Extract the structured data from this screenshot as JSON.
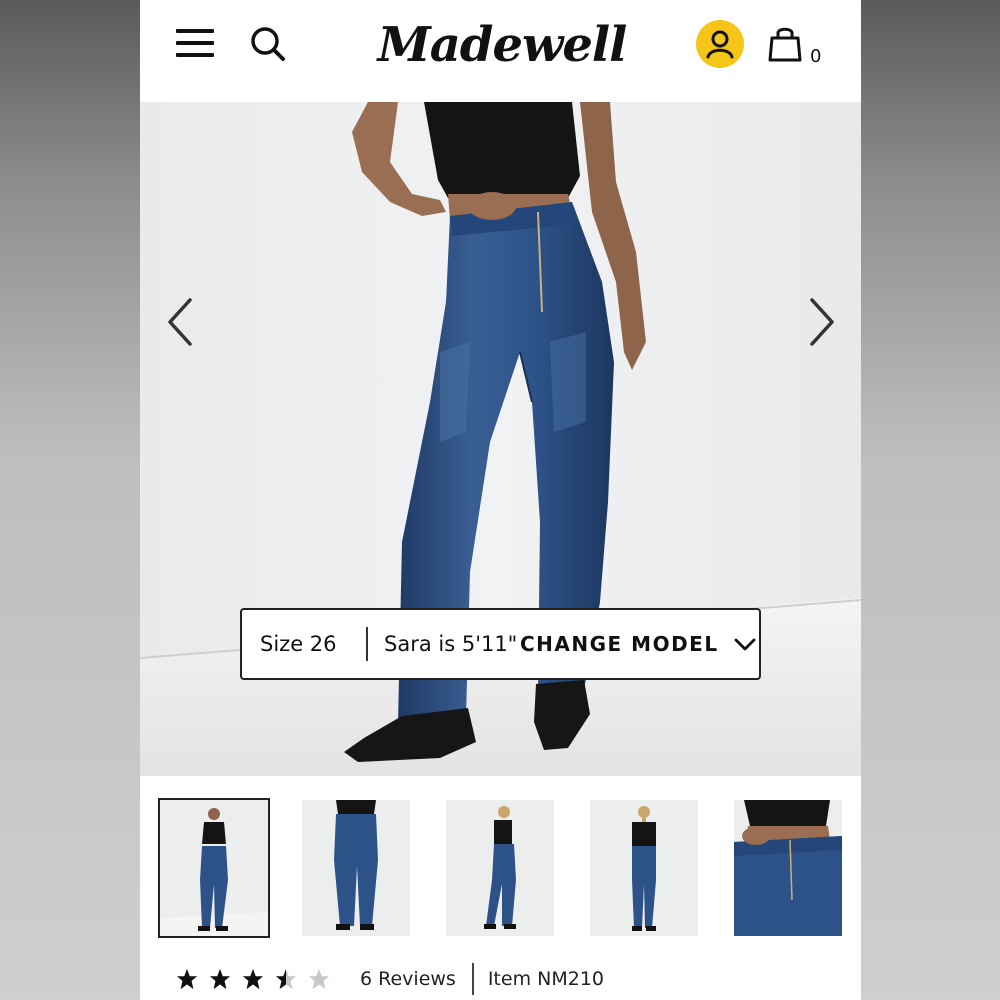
{
  "header": {
    "logo_text": "Madewell",
    "cart_count": "0",
    "icons": [
      "menu-icon",
      "search-icon",
      "account-icon",
      "bag-icon"
    ],
    "account_color": "#f5c518"
  },
  "hero": {
    "prev_icon": "chevron-left-icon",
    "next_icon": "chevron-right-icon",
    "model_bar": {
      "size": "Size 26",
      "model": "Sara is 5'11\"",
      "change_label": "CHANGE MODEL"
    }
  },
  "thumbnails": {
    "count": 5,
    "active_index": 0,
    "views": [
      "full-front",
      "jeans-front",
      "side",
      "back",
      "waist-detail"
    ]
  },
  "reviews": {
    "rating": 3.5,
    "max_rating": 5,
    "reviews_text": "6 Reviews",
    "item_text": "Item NM210"
  },
  "colors": {
    "denim": "#2e4f80",
    "top": "#141414",
    "skin": "#9a6e52"
  }
}
